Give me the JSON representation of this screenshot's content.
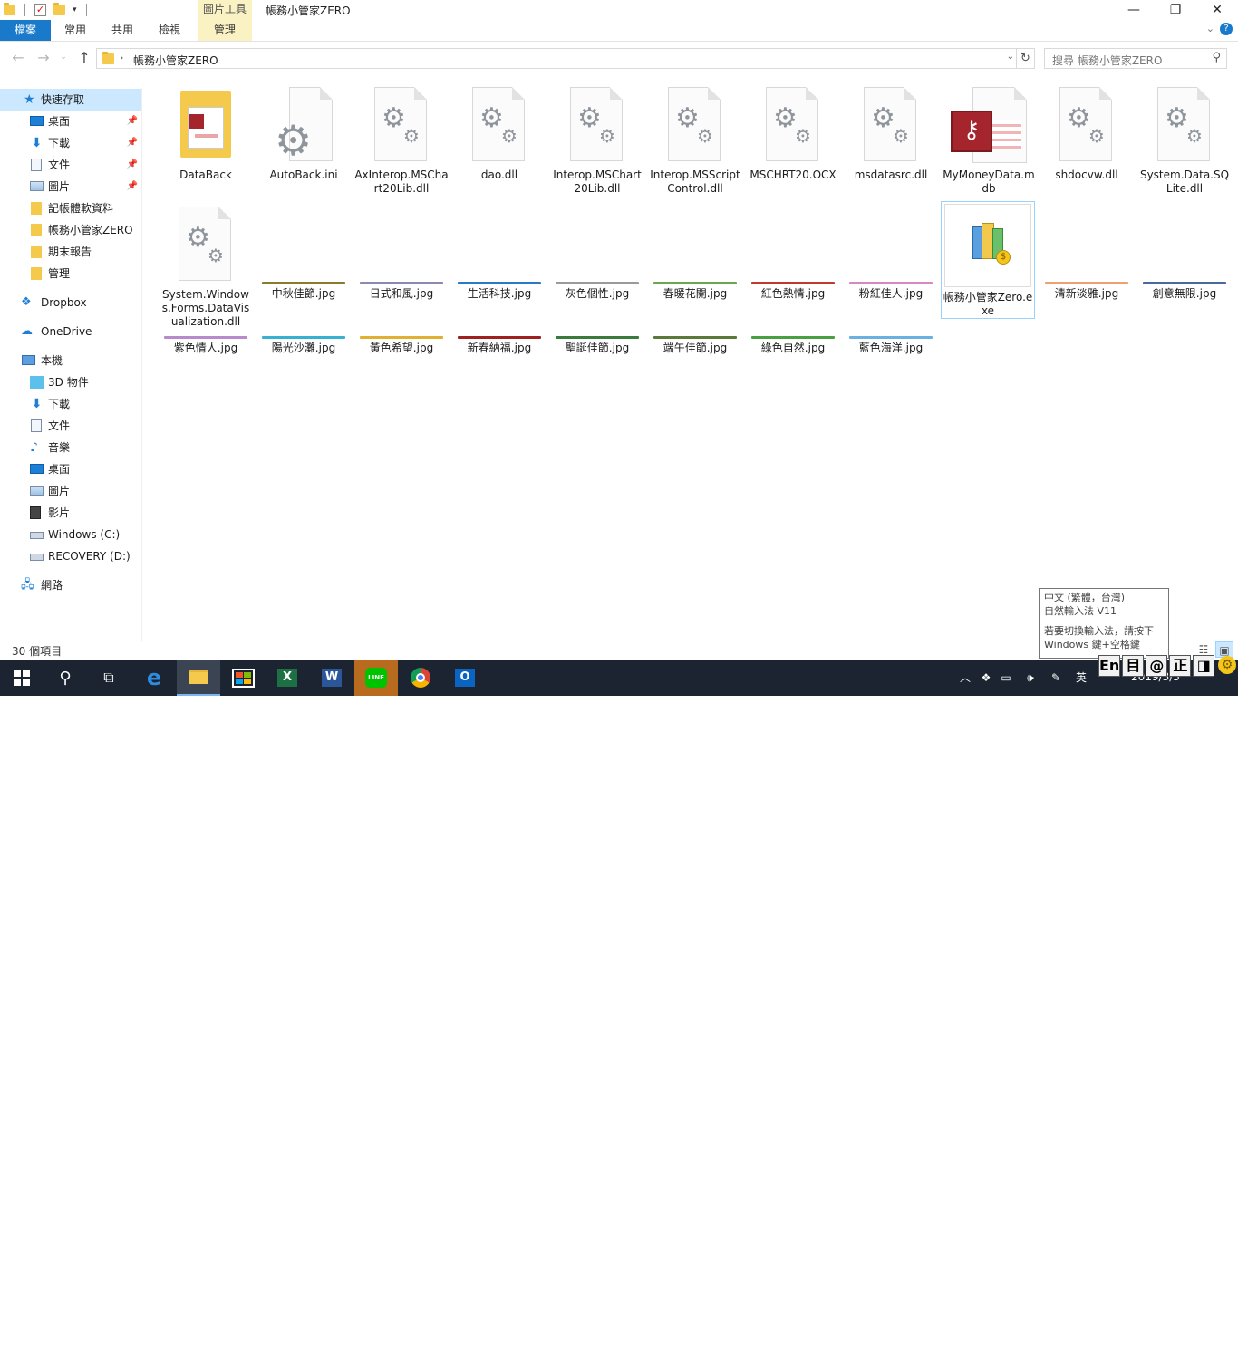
{
  "window": {
    "title": "帳務小管家ZERO",
    "context_tab_label": "圖片工具",
    "controls": {
      "minimize": "—",
      "restore": "❐",
      "close": "✕"
    }
  },
  "ribbon": {
    "tabs": [
      {
        "label": "檔案"
      },
      {
        "label": "常用"
      },
      {
        "label": "共用"
      },
      {
        "label": "檢視"
      },
      {
        "label": "管理"
      }
    ],
    "file_color": "#1979ca",
    "context_color": "#fbf2c4"
  },
  "address": {
    "path": "帳務小管家ZERO",
    "search_placeholder": "搜尋 帳務小管家ZERO"
  },
  "sidebar": {
    "items": [
      {
        "label": "快速存取"
      },
      {
        "label": "桌面"
      },
      {
        "label": "下載"
      },
      {
        "label": "文件"
      },
      {
        "label": "圖片"
      },
      {
        "label": "記帳體軟資料"
      },
      {
        "label": "帳務小管家ZERO"
      },
      {
        "label": "期末報告"
      },
      {
        "label": "管理"
      },
      {
        "label": "Dropbox"
      },
      {
        "label": "OneDrive"
      },
      {
        "label": "本機"
      },
      {
        "label": "3D 物件"
      },
      {
        "label": "下載"
      },
      {
        "label": "文件"
      },
      {
        "label": "音樂"
      },
      {
        "label": "桌面"
      },
      {
        "label": "圖片"
      },
      {
        "label": "影片"
      },
      {
        "label": "Windows (C:)"
      },
      {
        "label": "RECOVERY (D:)"
      },
      {
        "label": "網路"
      }
    ]
  },
  "files": [
    {
      "name": "DataBack",
      "icon": "access-folder-icon"
    },
    {
      "name": "AutoBack.ini",
      "icon": "settings-file-icon"
    },
    {
      "name": "AxInterop.MSChart20Lib.dll",
      "icon": "dll-file-icon"
    },
    {
      "name": "dao.dll",
      "icon": "dll-file-icon"
    },
    {
      "name": "Interop.MSChart20Lib.dll",
      "icon": "dll-file-icon"
    },
    {
      "name": "Interop.MSScriptControl.dll",
      "icon": "dll-file-icon"
    },
    {
      "name": "MSCHRT20.OCX",
      "icon": "dll-file-icon"
    },
    {
      "name": "msdatasrc.dll",
      "icon": "dll-file-icon"
    },
    {
      "name": "MyMoneyData.mdb",
      "icon": "access-db-icon"
    },
    {
      "name": "shdocvw.dll",
      "icon": "dll-file-icon"
    },
    {
      "name": "System.Data.SQLite.dll",
      "icon": "dll-file-icon"
    },
    {
      "name": "System.Windows.Forms.DataVisualization.dll",
      "icon": "dll-file-icon"
    },
    {
      "name": "中秋佳節.jpg",
      "strip": "#8a7a2a"
    },
    {
      "name": "日式和風.jpg",
      "strip": "#8a8ab0"
    },
    {
      "name": "生活科技.jpg",
      "strip": "#2a78c8"
    },
    {
      "name": "灰色個性.jpg",
      "strip": "#9a9a9a"
    },
    {
      "name": "春暖花開.jpg",
      "strip": "#6aa84f"
    },
    {
      "name": "紅色熱情.jpg",
      "strip": "#c0392b"
    },
    {
      "name": "粉紅佳人.jpg",
      "strip": "#d987c0"
    },
    {
      "name": "帳務小管家Zero.exe",
      "icon": "app-exe-icon"
    },
    {
      "name": "清新淡雅.jpg",
      "strip": "#f0a070"
    },
    {
      "name": "創意無限.jpg",
      "strip": "#4a6a9a"
    },
    {
      "name": "紫色情人.jpg",
      "strip": "#b98acb"
    },
    {
      "name": "陽光沙灘.jpg",
      "strip": "#3ab0d0"
    },
    {
      "name": "黃色希望.jpg",
      "strip": "#e0b030"
    },
    {
      "name": "新春納福.jpg",
      "strip": "#a02020"
    },
    {
      "name": "聖誕佳節.jpg",
      "strip": "#3a7a3a"
    },
    {
      "name": "端午佳節.jpg",
      "strip": "#5a7a3a"
    },
    {
      "name": "綠色自然.jpg",
      "strip": "#4aa040"
    },
    {
      "name": "藍色海洋.jpg",
      "strip": "#6ab0e0"
    }
  ],
  "status": {
    "count": "30 個項目"
  },
  "ime_tooltip": {
    "line1": "中文 (繁體，台灣)",
    "line2": "自然輸入法 V11",
    "line3": "若要切換輸入法，請按下",
    "line4": "Windows 鍵+空格鍵"
  },
  "taskbar": {
    "ime_indicator": "英",
    "ime_toolbar": [
      "En",
      "目",
      "@",
      "正",
      "◨"
    ],
    "date": "2019/3/5",
    "notifications": "5"
  }
}
